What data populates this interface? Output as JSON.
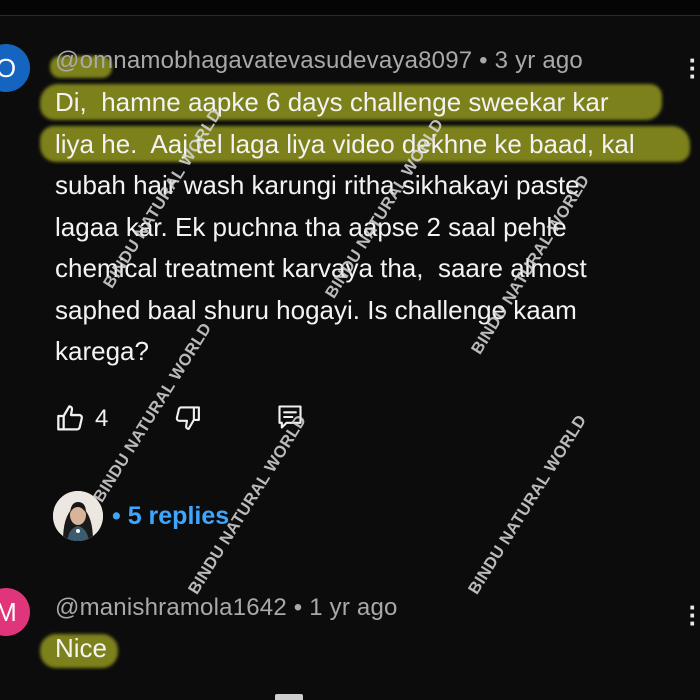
{
  "comments": [
    {
      "avatar_letter": "O",
      "avatar_color": "#1565c0",
      "meta": "@omnamobhagavatevasudevaya8097 • 3 yr ago",
      "lines": [
        "Di,  hamne aapke 6 days challenge sweekar kar",
        "liya he.  Aaj tel laga liya video dekhne ke baad, kal",
        "subah hair wash karungi ritha sikhakayi paste",
        "lagaa kar. Ek puchna tha aapse 2 saal pehle",
        "chemical treatment karvaya tha,  saare almost",
        "saphed baal shuru hogayi. Is challenge kaam",
        "karega?"
      ],
      "like_count": "4",
      "replies_label": "• 5 replies"
    },
    {
      "avatar_letter": "M",
      "avatar_color": "#e0357a",
      "meta": "@manishramola1642 • 1 yr ago",
      "text": "Nice"
    }
  ],
  "watermark": "BINDU NATURAL WORLD",
  "colors": {
    "highlight": "#d8e228",
    "link": "#3ea6ff",
    "background": "#0c0c0c"
  },
  "icons": [
    "thumb-up-icon",
    "thumb-down-icon",
    "reply-icon",
    "more-vert-icon"
  ]
}
